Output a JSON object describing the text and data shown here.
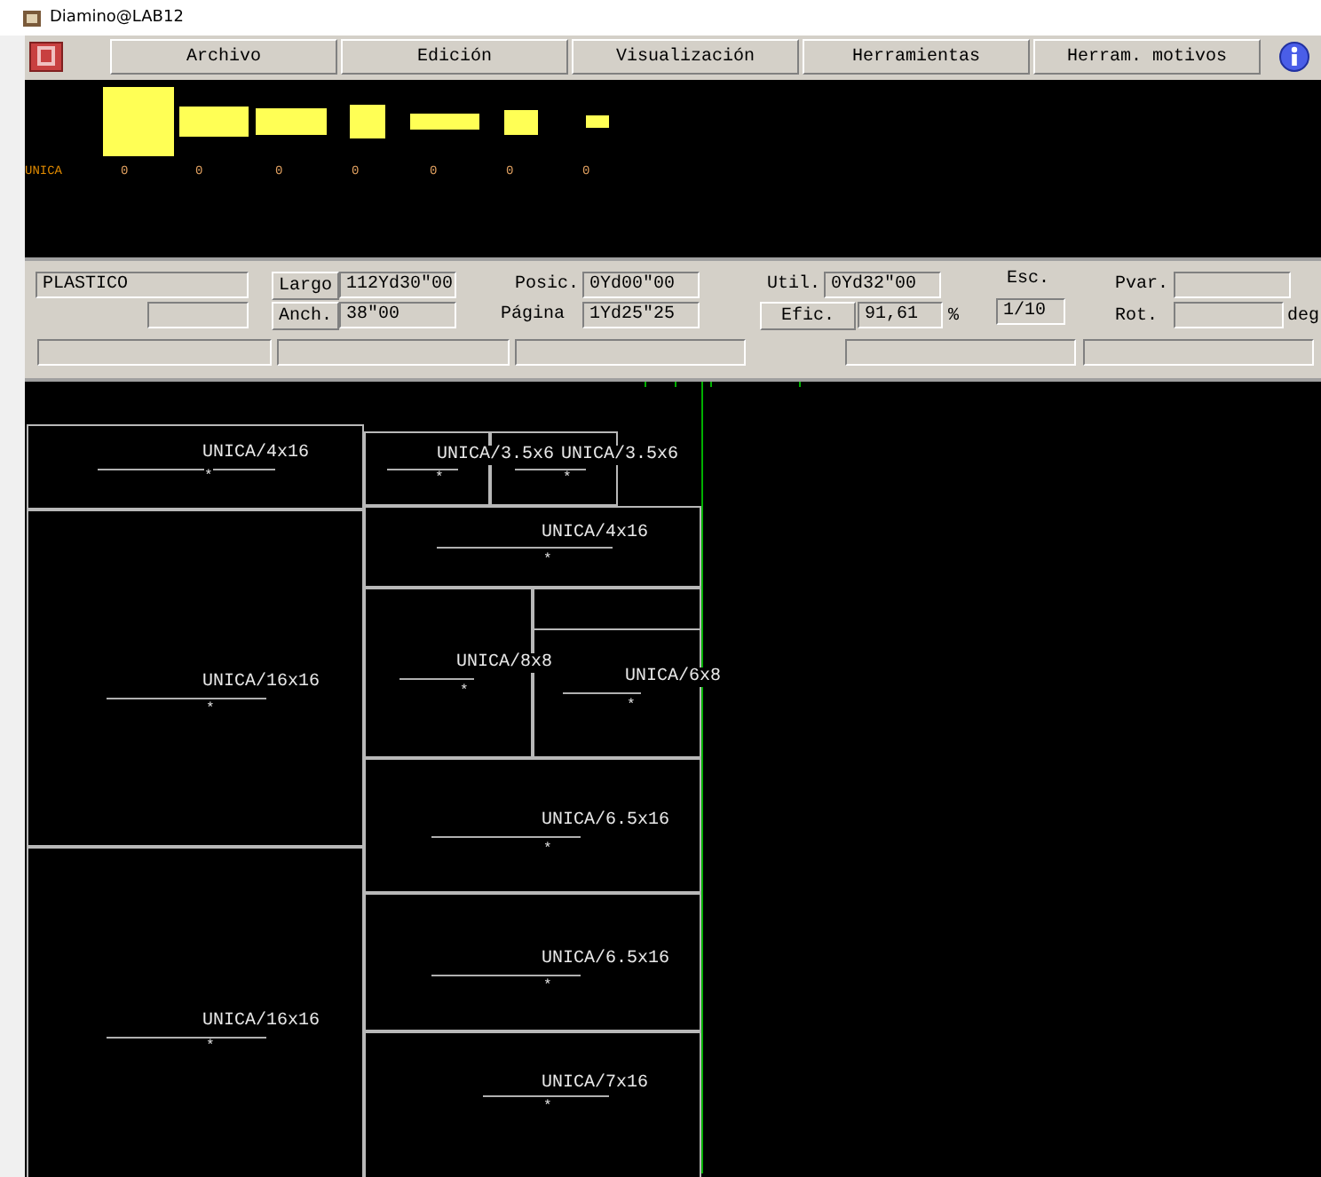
{
  "window": {
    "title": "Diamino@LAB12"
  },
  "menu": [
    {
      "label": "Archivo"
    },
    {
      "label": "Edición"
    },
    {
      "label": "Visualización"
    },
    {
      "label": "Herramientas"
    },
    {
      "label": "Herram. motivos"
    }
  ],
  "sizes": {
    "model": "UNICA",
    "counts": [
      "0",
      "0",
      "0",
      "0",
      "0",
      "0",
      "0"
    ]
  },
  "panel": {
    "material": "PLASTICO",
    "largo": {
      "label": "Largo",
      "value": "112Yd30\"00"
    },
    "anch": {
      "label": "Anch.",
      "value": "38\"00"
    },
    "posic": {
      "label": "Posic.",
      "value": "0Yd00\"00"
    },
    "pagina": {
      "label": "Página",
      "value": "1Yd25\"25"
    },
    "util": {
      "label": "Util.",
      "value": "0Yd32\"00"
    },
    "efic": {
      "label": "Efic.",
      "value": "91,61",
      "unit": "%"
    },
    "esc": {
      "label": "Esc.",
      "value": "1/10"
    },
    "pvar": {
      "label": "Pvar."
    },
    "rot": {
      "label": "Rot.",
      "unit": "deg"
    }
  },
  "pieces": [
    {
      "label": "UNICA/4x16",
      "mark": "*"
    },
    {
      "label": "UNICA/3.5x6",
      "mark": "*"
    },
    {
      "label": "UNICA/3.5x6",
      "mark": "*"
    },
    {
      "label": "UNICA/4x16",
      "mark": "*"
    },
    {
      "label": "UNICA/16x16",
      "mark": "*"
    },
    {
      "label": "UNICA/8x8",
      "mark": "*"
    },
    {
      "label": "UNICA/6x8",
      "mark": "*"
    },
    {
      "label": "UNICA/6.5x16",
      "mark": "*"
    },
    {
      "label": "UNICA/6.5x16",
      "mark": "*"
    },
    {
      "label": "UNICA/16x16",
      "mark": "*"
    },
    {
      "label": "UNICA/7x16",
      "mark": "*"
    }
  ]
}
